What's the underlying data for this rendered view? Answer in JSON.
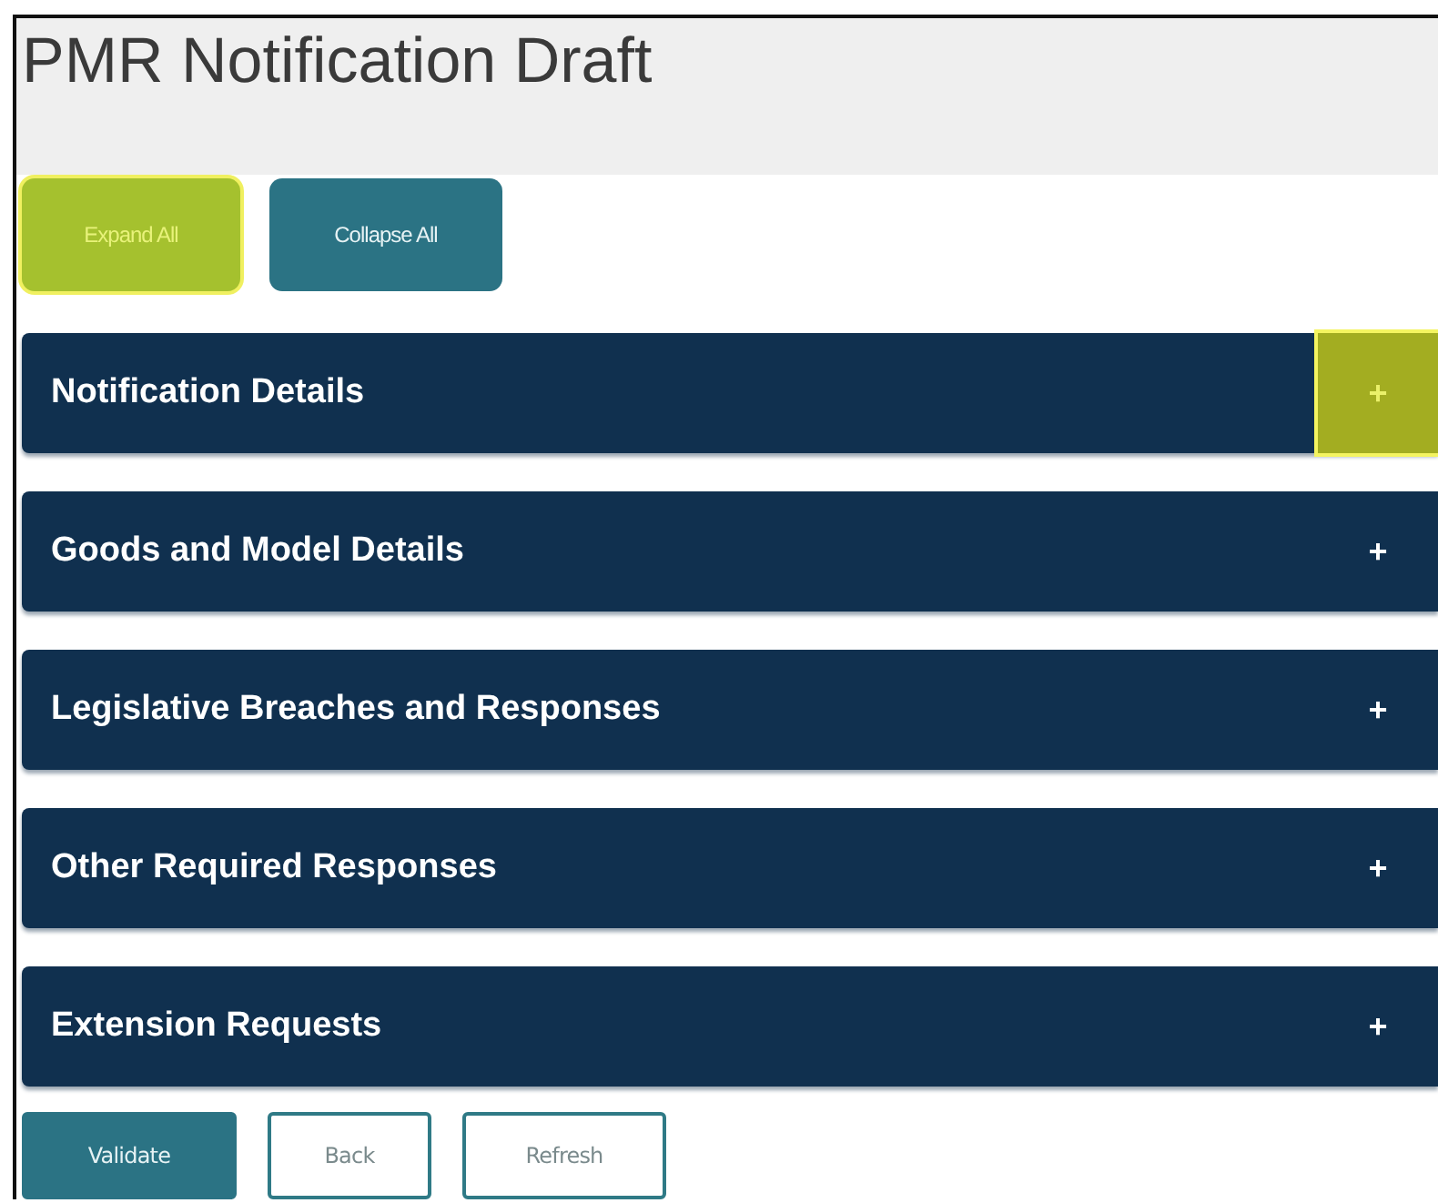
{
  "page_title": "PMR Notification Draft",
  "top_buttons": [
    {
      "label": "Expand All",
      "kind": "lime",
      "focused": true
    },
    {
      "label": "Collapse All",
      "kind": "teal",
      "focused": false
    }
  ],
  "sections": [
    {
      "title": "Notification Details",
      "toggle": "+",
      "focused": true
    },
    {
      "title": "Goods and Model Details",
      "toggle": "+",
      "focused": false
    },
    {
      "title": "Legislative Breaches and Responses",
      "toggle": "+",
      "focused": false
    },
    {
      "title": "Other Required Responses",
      "toggle": "+",
      "focused": false
    },
    {
      "title": "Extension Requests",
      "toggle": "+",
      "focused": false
    }
  ],
  "bottom_buttons": [
    {
      "label": "Validate",
      "kind": "teal"
    },
    {
      "label": "Back",
      "kind": "outline"
    },
    {
      "label": "Refresh",
      "kind": "outline"
    }
  ]
}
